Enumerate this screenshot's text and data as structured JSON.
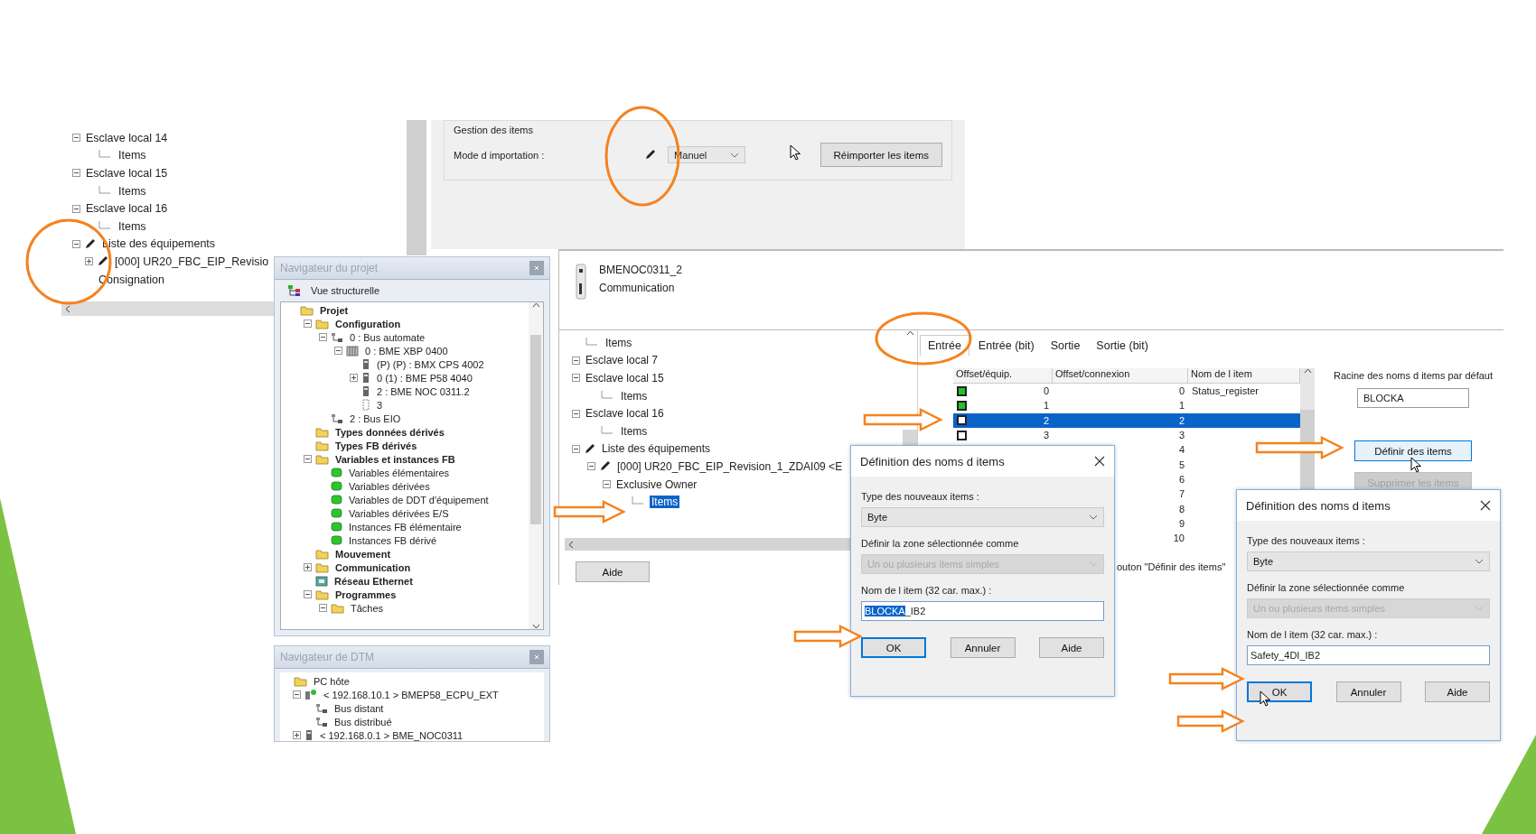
{
  "device_panel": {
    "tree": [
      {
        "label": "Esclave local 14",
        "kind": "plain",
        "expanded": true,
        "children": [
          {
            "label": "Items"
          }
        ]
      },
      {
        "label": "Esclave local 15",
        "kind": "plain",
        "expanded": true,
        "children": [
          {
            "label": "Items"
          }
        ]
      },
      {
        "label": "Esclave local 16",
        "kind": "plain",
        "expanded": true,
        "children": [
          {
            "label": "Items"
          }
        ]
      },
      {
        "label": "Liste des équipements",
        "kind": "pencil",
        "expanded": true,
        "children": [
          {
            "label": "[000] UR20_FBC_EIP_Revisio",
            "kind": "pencil",
            "expanded": false
          },
          {
            "label": "Consignation",
            "kind": "plain"
          }
        ]
      }
    ]
  },
  "import_panel": {
    "group_title": "Gestion des items",
    "mode_label": "Mode d importation :",
    "mode_value": "Manuel",
    "reimport_button": "Réimporter les items"
  },
  "project_navigator": {
    "title": "Navigateur du projet",
    "view_tab": "Vue structurelle",
    "tree": [
      {
        "label": "Projet",
        "kind": "folder",
        "children": [
          {
            "label": "Configuration",
            "kind": "folder",
            "expanded": true,
            "children": [
              {
                "label": "0 : Bus automate",
                "kind": "bus",
                "expanded": true,
                "children": [
                  {
                    "label": "0 : BME XBP 0400",
                    "kind": "rack",
                    "expanded": true,
                    "children": [
                      {
                        "label": "(P) (P) : BMX CPS 4002",
                        "kind": "module"
                      },
                      {
                        "label": "0 (1) : BME P58 4040",
                        "kind": "module",
                        "expanded": false
                      },
                      {
                        "label": "2 : BME NOC 0311.2",
                        "kind": "module"
                      },
                      {
                        "label": "3",
                        "kind": "slot"
                      }
                    ]
                  }
                ]
              },
              {
                "label": "2 : Bus EIO",
                "kind": "bus"
              }
            ]
          },
          {
            "label": "Types données dérivés",
            "kind": "folder"
          },
          {
            "label": "Types FB dérivés",
            "kind": "folder"
          },
          {
            "label": "Variables et instances FB",
            "kind": "folder",
            "expanded": true,
            "children": [
              {
                "label": "Variables élémentaires",
                "kind": "variable"
              },
              {
                "label": "Variables dérivées",
                "kind": "variable"
              },
              {
                "label": "Variables de DDT d'équipement",
                "kind": "variable"
              },
              {
                "label": "Variables dérivées E/S",
                "kind": "variable"
              },
              {
                "label": "Instances FB élémentaire",
                "kind": "variable"
              },
              {
                "label": "Instances FB dérivé",
                "kind": "variable"
              }
            ]
          },
          {
            "label": "Mouvement",
            "kind": "folder"
          },
          {
            "label": "Communication",
            "kind": "folder",
            "expanded": false
          },
          {
            "label": "Réseau Ethernet",
            "kind": "network"
          },
          {
            "label": "Programmes",
            "kind": "folder",
            "expanded": true,
            "children": [
              {
                "label": "Tâches",
                "kind": "folder",
                "expanded": true
              }
            ]
          }
        ]
      }
    ]
  },
  "dtm_navigator": {
    "title": "Navigateur de DTM",
    "tree": [
      {
        "label": "PC hôte",
        "kind": "folder",
        "children": [
          {
            "label": "< 192.168.10.1 > BMEP58_ECPU_EXT",
            "kind": "device",
            "expanded": true,
            "children": [
              {
                "label": "Bus distant",
                "kind": "bus"
              },
              {
                "label": "Bus distribué",
                "kind": "bus"
              }
            ]
          },
          {
            "label": "< 192.168.0.1 > BME_NOC0311",
            "kind": "module",
            "expanded": false
          }
        ]
      }
    ]
  },
  "device_editor": {
    "device_name": "BMENOC0311_2",
    "device_type": "Communication",
    "tree": [
      {
        "label": "Items",
        "selected": false
      },
      {
        "label": "Esclave local 7",
        "kind": "plain",
        "expanded": true,
        "selected": false
      },
      {
        "label": "Esclave local 15",
        "kind": "plain",
        "expanded": true,
        "selected": false,
        "children": [
          {
            "label": "Items",
            "selected": false
          }
        ]
      },
      {
        "label": "Esclave local 16",
        "kind": "plain",
        "expanded": true,
        "selected": false,
        "children": [
          {
            "label": "Items",
            "selected": false
          }
        ]
      },
      {
        "label": "Liste des équipements",
        "kind": "pencil",
        "expanded": true,
        "selected": false,
        "children": [
          {
            "label": "[000] UR20_FBC_EIP_Revision_1_ZDAI09 <E",
            "kind": "pencil",
            "expanded": true,
            "selected": false,
            "children": [
              {
                "label": "Exclusive Owner",
                "kind": "plain",
                "expanded": true,
                "selected": false,
                "children": [
                  {
                    "label": "Items",
                    "selected": true
                  }
                ]
              }
            ]
          }
        ]
      }
    ],
    "help_button": "Aide",
    "tabs": [
      {
        "label": "Entrée",
        "selected": true
      },
      {
        "label": "Entrée (bit)",
        "selected": false
      },
      {
        "label": "Sortie",
        "selected": false
      },
      {
        "label": "Sortie (bit)",
        "selected": false
      }
    ],
    "columns": [
      "Offset/équip.",
      "Offset/connexion",
      "Nom de l item"
    ],
    "rows": [
      {
        "filled": true,
        "offset_equip": "0",
        "offset_connexion": "0",
        "name": "Status_register",
        "selected": false
      },
      {
        "filled": true,
        "offset_equip": "1",
        "offset_connexion": "1",
        "selected": false
      },
      {
        "filled": false,
        "offset_equip": "2",
        "offset_connexion": "2",
        "selected": true
      },
      {
        "filled": false,
        "offset_equip": "3",
        "offset_connexion": "3",
        "selected": false
      },
      {
        "offset_connexion": "4",
        "selected": false
      },
      {
        "offset_connexion": "5",
        "selected": false
      },
      {
        "offset_connexion": "6",
        "selected": false
      },
      {
        "offset_connexion": "7",
        "selected": false
      },
      {
        "offset_connexion": "8",
        "selected": false
      },
      {
        "offset_connexion": "9",
        "selected": false
      },
      {
        "offset_connexion": "10",
        "selected": false
      }
    ],
    "root_label": "Racine des noms d items par défaut",
    "root_value": "BLOCKA",
    "define_button": "Définir des items",
    "delete_button": {
      "label": "Supprimer les items",
      "disabled": true
    },
    "hint_fragment": "outon \"Définir des items\""
  },
  "dialogs": [
    {
      "title": "Définition des noms d items",
      "type_label": "Type des nouveaux items :",
      "type_value": "Byte",
      "zone_label": "Définir la zone sélectionnée comme",
      "zone_value": "Un ou plusieurs items simples",
      "name_label": "Nom de l item (32 car. max.) :",
      "name_selected": "BLOCKA",
      "name_value": "_IB2",
      "buttons": [
        "OK",
        "Annuler",
        "Aide"
      ]
    },
    {
      "title": "Définition des noms d items",
      "type_label": "Type des nouveaux items :",
      "type_value": "Byte",
      "zone_label": "Définir la zone sélectionnée comme",
      "zone_value": "Un ou plusieurs items simples",
      "name_label": "Nom de l item (32 car. max.) :",
      "name_value": "Safety_4DI_IB2",
      "buttons": [
        "OK",
        "Annuler",
        "Aide"
      ]
    }
  ]
}
